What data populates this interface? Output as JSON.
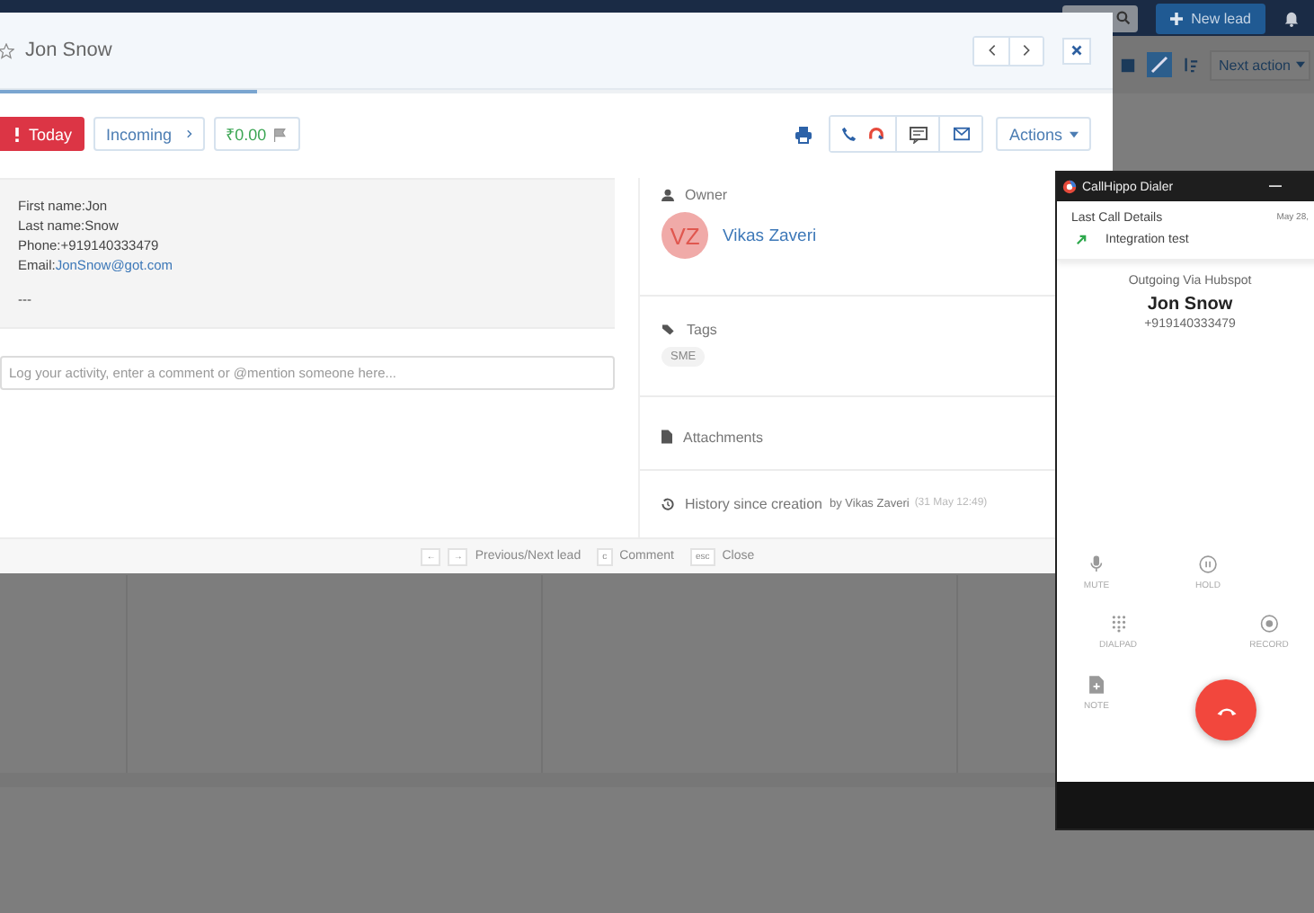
{
  "app": {
    "new_lead_button": "New lead",
    "next_action_button": "Next action"
  },
  "modal": {
    "title": "Jon Snow",
    "starred": false,
    "badges": {
      "due": "Today",
      "stage": "Incoming",
      "value": "₹0.00"
    },
    "actions_button": "Actions",
    "details": [
      {
        "label": "First name:",
        "value": "Jon",
        "link": false
      },
      {
        "label": "Last name:",
        "value": "Snow",
        "link": false
      },
      {
        "label": "Phone:",
        "value": "+919140333479",
        "link": false
      },
      {
        "label": "Email:",
        "value": "JonSnow@got.com",
        "link": true
      }
    ],
    "details_separator": "---",
    "comment": {
      "placeholder": "Log your activity, enter a comment or @mention someone here..."
    },
    "owner": {
      "heading": "Owner",
      "initials": "VZ",
      "name": "Vikas Zaveri"
    },
    "tags": {
      "heading": "Tags",
      "items": [
        "SME"
      ]
    },
    "attachments": {
      "heading": "Attachments"
    },
    "history": {
      "heading": "History since creation",
      "author": "by Vikas Zaveri",
      "time": "(31 May 12:49)"
    },
    "shortcuts": [
      {
        "keys": [
          "←",
          "→"
        ],
        "label": "Previous/Next lead"
      },
      {
        "keys": [
          "c"
        ],
        "label": "Comment"
      },
      {
        "keys": [
          "esc"
        ],
        "label": "Close"
      }
    ]
  },
  "dialer": {
    "title": "CallHippo Dialer",
    "last_call_heading": "Last Call Details",
    "last_call_date": "May 28,",
    "last_call_name": "Integration test",
    "direction": "Outgoing Via Hubspot",
    "contact_name": "Jon Snow",
    "contact_number": "+919140333479",
    "controls": [
      {
        "kind": "mute",
        "label": "MUTE"
      },
      {
        "kind": "hold",
        "label": "HOLD"
      },
      {
        "kind": "dialpad",
        "label": "DIALPAD"
      },
      {
        "kind": "record",
        "label": "RECORD"
      },
      {
        "kind": "note",
        "label": "NOTE"
      }
    ]
  }
}
